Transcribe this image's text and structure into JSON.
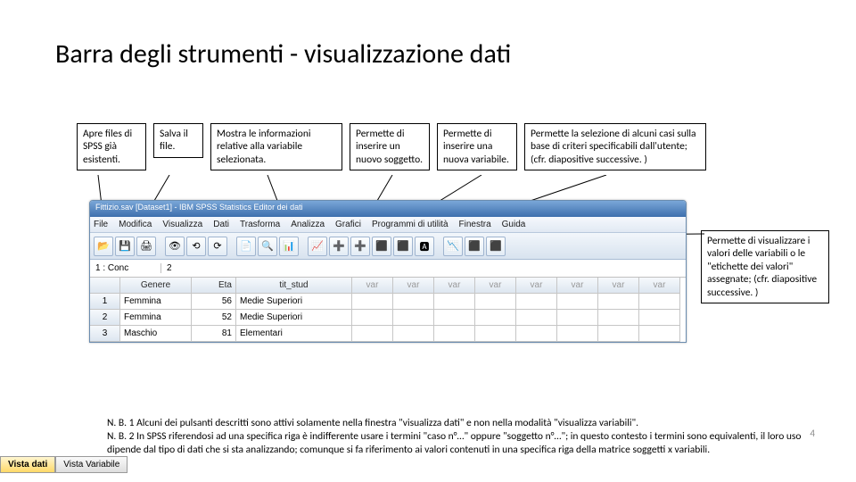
{
  "title": "Barra degli strumenti - visualizzazione dati",
  "callouts": {
    "c1": "Apre files di SPSS già esistenti.",
    "c2": "Salva il file.",
    "c3": "Mostra le informazioni relative alla variabile selezionata.",
    "c4": "Permette di inserire un nuovo soggetto.",
    "c5": "Permette di inserire una nuova variabile.",
    "c6": "Permette la selezione di alcuni casi sulla base di criteri specificabili dall'utente; (cfr. diapositive successive. )",
    "c7": "Permette di visualizzare i valori delle variabili o le \"etichette dei valori\" assegnate; (cfr. diapositive successive. )"
  },
  "spss": {
    "title": "Fittizio.sav [Dataset1] - IBM SPSS Statistics Editor dei dati",
    "menu": [
      "File",
      "Modifica",
      "Visualizza",
      "Dati",
      "Trasforma",
      "Analizza",
      "Grafici",
      "Programmi di utilità",
      "Finestra",
      "Guida"
    ],
    "cell_addr": "1 : Conc",
    "cell_val": "2",
    "headers": [
      "Genere",
      "Eta",
      "tit_stud"
    ],
    "var_placeholder": "var",
    "rows": [
      {
        "n": "1",
        "genere": "Femmina",
        "eta": "56",
        "tit": "Medie Superiori"
      },
      {
        "n": "2",
        "genere": "Femmina",
        "eta": "52",
        "tit": "Medie Superiori"
      },
      {
        "n": "3",
        "genere": "Maschio",
        "eta": "81",
        "tit": "Elementari"
      }
    ],
    "toolbar_icons": [
      "📂",
      "💾",
      "🖨",
      "👁",
      "⟲",
      "⟳",
      "📄",
      "🔍",
      "📊",
      "📈",
      "➕",
      "➕",
      "⬛",
      "⬛",
      "🅰",
      "📉",
      "⬛",
      "⬛"
    ]
  },
  "tabs": {
    "active": "Vista dati",
    "inactive": "Vista Variabile"
  },
  "notes": {
    "n1": "N. B. 1 Alcuni dei pulsanti descritti sono attivi solamente nella finestra \"visualizza dati\" e non nella modalità \"visualizza variabili\".",
    "n2": "N. B. 2 In SPSS riferendosi ad una specifica riga è indifferente usare i termini \"caso n°…\" oppure \"soggetto n°…\"; in questo contesto i termini sono equivalenti, il loro uso dipende dal tipo di dati che si sta analizzando; comunque si fa riferimento ai valori contenuti in una specifica riga della matrice soggetti x variabili."
  },
  "page_num": "4"
}
